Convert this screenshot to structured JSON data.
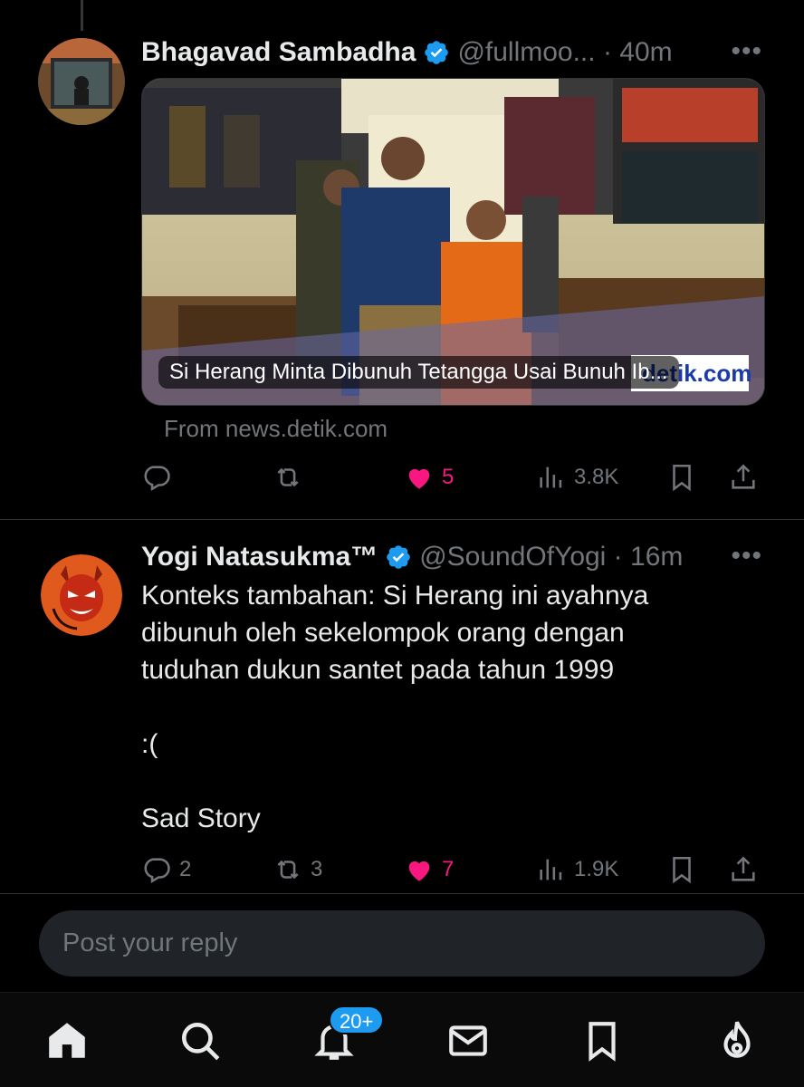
{
  "tweets": [
    {
      "name": "Bhagavad Sambadha",
      "handle": "@fullmoo... · 40m",
      "more": "•••",
      "card": {
        "title": "Si Herang Minta Dibunuh Tetangga Usai Bunuh Ib...",
        "source": "From news.detik.com",
        "watermark": "detik.com"
      },
      "stats": {
        "replies": "",
        "reposts": "",
        "likes": "5",
        "views": "3.8K"
      }
    },
    {
      "name": "Yogi Natasukma™",
      "handle": "@SoundOfYogi · 16m",
      "more": "•••",
      "text": "Konteks tambahan: Si Herang ini ayahnya\ndibunuh oleh sekelompok orang dengan\ntuduhan dukun santet pada tahun 1999\n\n:(\n\nSad Story",
      "stats": {
        "replies": "2",
        "reposts": "3",
        "likes": "7",
        "views": "1.9K"
      }
    }
  ],
  "reply": {
    "placeholder": "Post your reply"
  },
  "nav": {
    "items": [
      "home-icon",
      "search-icon",
      "notifications-icon",
      "messages-icon",
      "bookmarks-icon",
      "grok-icon"
    ],
    "notifications_badge": "20+"
  },
  "colors": {
    "background": "#000000",
    "text": "#e7e9ea",
    "muted": "#71767b",
    "like": "#f91880",
    "verified": "#1d9bf0"
  }
}
